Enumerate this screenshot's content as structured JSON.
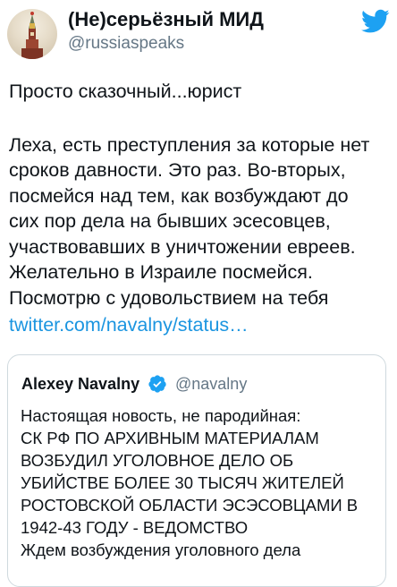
{
  "author": {
    "name": "(Не)серьёзный МИД",
    "handle": "@russiaspeaks",
    "avatar_icon": "kremlin-tower-avatar"
  },
  "brand_icon": "twitter-bird-icon",
  "tweet": {
    "lines": [
      "Просто сказочный...юрист",
      "",
      "Леха, есть преступления за которые нет",
      "сроков давности. Это раз. Во-вторых,",
      "посмейся над тем, как возбуждают до",
      "сих пор дела на бывших эсесовцев,",
      "участвовавших в уничтожении евреев.",
      "Желательно в Израиле посмейся.",
      "Посмотрю с удовольствием на тебя"
    ],
    "link": "twitter.com/navalny/status…"
  },
  "quoted": {
    "name": "Alexey Navalny",
    "handle": "@navalny",
    "verified_icon": "verified-badge-icon",
    "lines": [
      "Настоящая новость, не пародийная:",
      "СК РФ ПО АРХИВНЫМ МАТЕРИАЛАМ",
      "ВОЗБУДИЛ УГОЛОВНОЕ ДЕЛО ОБ",
      "УБИЙСТВЕ БОЛЕЕ 30 ТЫСЯЧ ЖИТЕЛЕЙ",
      "РОСТОВСКОЙ ОБЛАСТИ ЭСЭСОВЦАМИ В",
      "1942-43 ГОДУ - ВЕДОМСТВО",
      "Ждем возбуждения уголовного дела"
    ]
  },
  "colors": {
    "link": "#1b95e0",
    "secondary_text": "#657786",
    "border": "#cfd9de",
    "twitter_blue": "#1da1f2"
  }
}
